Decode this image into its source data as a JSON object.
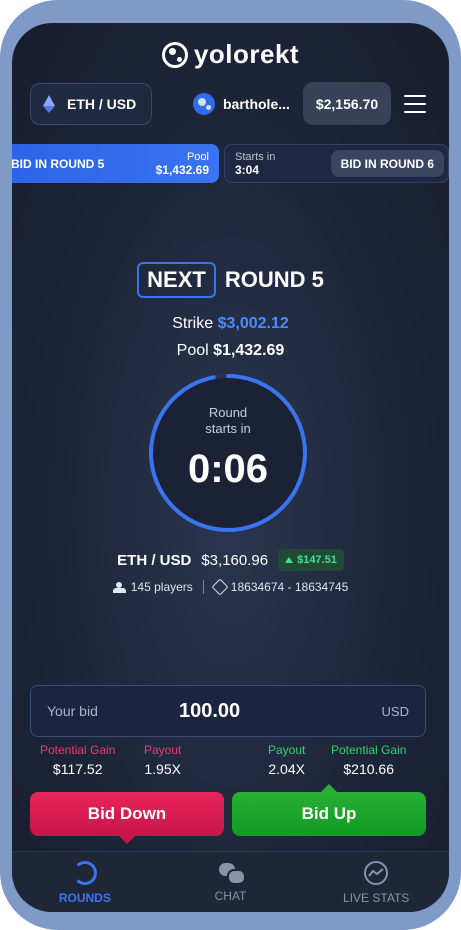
{
  "header": {
    "logo_text": "yolorekt",
    "pair": "ETH / USD",
    "username": "barthole...",
    "balance": "$2,156.70"
  },
  "rounds_strip": {
    "active": {
      "prefix": "BID IN",
      "round": "ROUND 5",
      "pool_label": "Pool",
      "pool_value": "$1,432.69"
    },
    "next": {
      "starts_label": "Starts in",
      "starts_value": "3:04",
      "prefix": "BID IN",
      "round": "ROUND 6"
    }
  },
  "round": {
    "badge": "NEXT",
    "name": "ROUND 5",
    "strike_label": "Strike",
    "strike_value": "$3,002.12",
    "pool_label": "Pool",
    "pool_value": "$1,432.69",
    "timer_label_1": "Round",
    "timer_label_2": "starts in",
    "timer_value": "0:06",
    "timer_progress": 0.97
  },
  "market": {
    "pair": "ETH / USD",
    "price": "$3,160.96",
    "delta": "$147.51",
    "players": "145 players",
    "blocks": "18634674 - 18634745"
  },
  "bid": {
    "label": "Your bid",
    "value": "100.00",
    "unit": "USD"
  },
  "down_stats": {
    "gain_label": "Potential Gain",
    "gain_value": "$117.52",
    "payout_label": "Payout",
    "payout_value": "1.95X"
  },
  "up_stats": {
    "payout_label": "Payout",
    "payout_value": "2.04X",
    "gain_label": "Potential Gain",
    "gain_value": "$210.66"
  },
  "buttons": {
    "down": "Bid Down",
    "up": "Bid Up"
  },
  "nav": {
    "rounds": "ROUNDS",
    "chat": "CHAT",
    "live_stats": "LIVE STATS"
  },
  "colors": {
    "accent": "#3b74f0",
    "down": "#e8255b",
    "up": "#27b032",
    "strike": "#4a8cff"
  }
}
